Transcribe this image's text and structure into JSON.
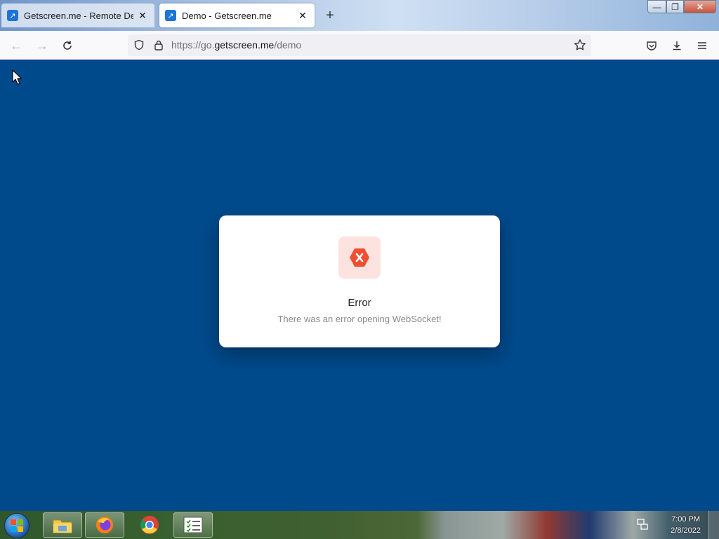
{
  "browser": {
    "tabs": [
      {
        "title": "Getscreen.me - Remote Desktop",
        "active": false,
        "favicon": "getscreen-arrow-icon"
      },
      {
        "title": "Demo - Getscreen.me",
        "active": true,
        "favicon": "getscreen-arrow-icon"
      }
    ],
    "new_tab_glyph": "+",
    "url_prefix": "https://go.",
    "url_host": "getscreen.me",
    "url_path": "/demo"
  },
  "window_controls": {
    "minimize": "—",
    "restore": "❐",
    "close": "✕"
  },
  "dialog": {
    "title": "Error",
    "message": "There was an error opening WebSocket!",
    "icon": "error-hexagon-icon",
    "accent_color": "#f04e30"
  },
  "colors": {
    "page_background": "#004a8c",
    "dialog_background": "#ffffff"
  },
  "taskbar": {
    "pinned": [
      "windows-explorer-icon",
      "firefox-icon",
      "chrome-icon",
      "task-list-icon"
    ],
    "clock_time": "7:00 PM",
    "clock_date": "2/8/2022"
  }
}
